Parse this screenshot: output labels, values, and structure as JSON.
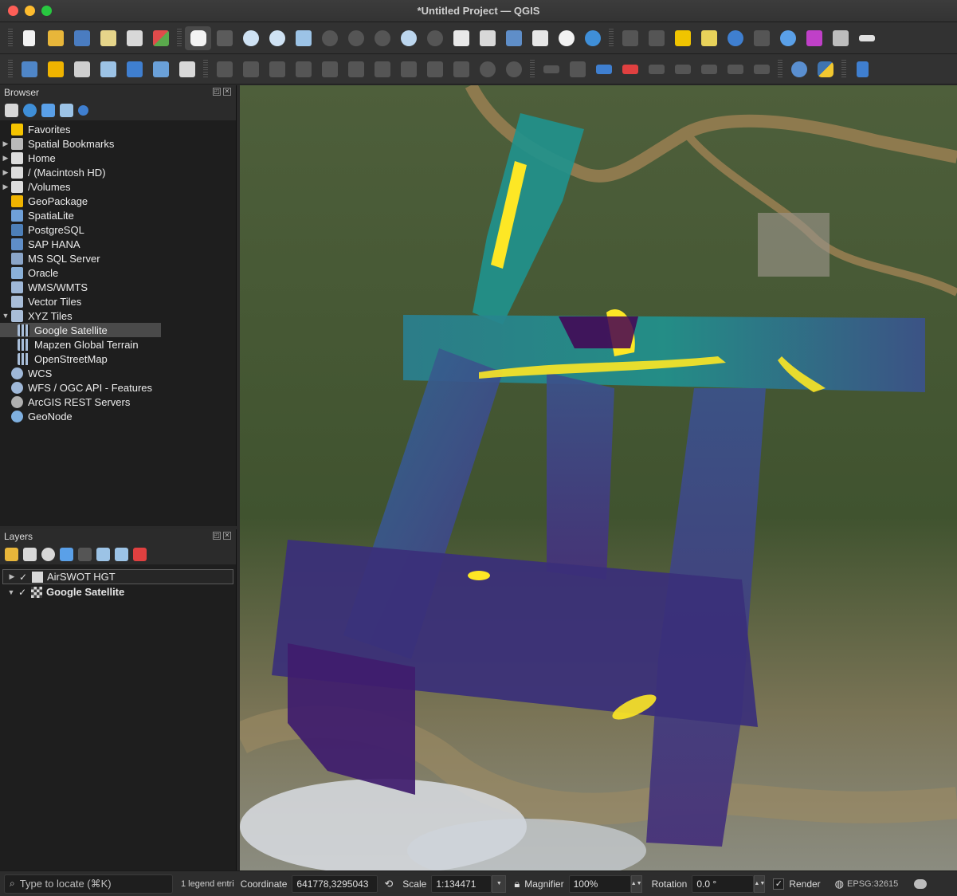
{
  "window": {
    "title": "*Untitled Project — QGIS",
    "traffic_lights": [
      "#fe5f57",
      "#febc2e",
      "#28c840"
    ]
  },
  "browser": {
    "title": "Browser",
    "items": [
      {
        "label": "Favorites",
        "icon": "star-icon",
        "color": "#f5c400",
        "arrow": ""
      },
      {
        "label": "Spatial Bookmarks",
        "icon": "bookmark-icon",
        "color": "#b9b9b9",
        "arrow": "▶"
      },
      {
        "label": "Home",
        "icon": "home-folder-icon",
        "color": "#dcdcdc",
        "arrow": "▶"
      },
      {
        "label": "/ (Macintosh HD)",
        "icon": "folder-icon",
        "color": "#dcdcdc",
        "arrow": "▶"
      },
      {
        "label": "/Volumes",
        "icon": "folder-icon",
        "color": "#dcdcdc",
        "arrow": "▶"
      },
      {
        "label": "GeoPackage",
        "icon": "geopackage-icon",
        "color": "#f0b400",
        "arrow": ""
      },
      {
        "label": "SpatiaLite",
        "icon": "spatialite-icon",
        "color": "#6fa0d8",
        "arrow": ""
      },
      {
        "label": "PostgreSQL",
        "icon": "postgresql-icon",
        "color": "#4d7fb8",
        "arrow": ""
      },
      {
        "label": "SAP HANA",
        "icon": "sap-hana-icon",
        "color": "#5f8ec8",
        "arrow": ""
      },
      {
        "label": "MS SQL Server",
        "icon": "mssql-icon",
        "color": "#8aa5c8",
        "arrow": ""
      },
      {
        "label": "Oracle",
        "icon": "oracle-icon",
        "color": "#8ab0d8",
        "arrow": ""
      },
      {
        "label": "WMS/WMTS",
        "icon": "globe-icon",
        "color": "#9fb8d8",
        "arrow": ""
      },
      {
        "label": "Vector Tiles",
        "icon": "grid-icon",
        "color": "#a8bdd8",
        "arrow": ""
      },
      {
        "label": "XYZ Tiles",
        "icon": "grid-icon",
        "color": "#a8bdd8",
        "arrow": "▼"
      }
    ],
    "xyz_children": [
      {
        "label": "Google Satellite",
        "selected": true
      },
      {
        "label": "Mapzen Global Terrain",
        "selected": false
      },
      {
        "label": "OpenStreetMap",
        "selected": false
      }
    ],
    "items_after": [
      {
        "label": "WCS",
        "icon": "globe-icon",
        "color": "#9fb8d8"
      },
      {
        "label": "WFS / OGC API - Features",
        "icon": "globe-icon",
        "color": "#9fb8d8"
      },
      {
        "label": "ArcGIS REST Servers",
        "icon": "arcgis-icon",
        "color": "#b0b0b0"
      },
      {
        "label": "GeoNode",
        "icon": "geonode-icon",
        "color": "#7fb0e0"
      }
    ]
  },
  "layers": {
    "title": "Layers",
    "items": [
      {
        "label": "AirSWOT HGT",
        "bold": false,
        "checked": "✓",
        "arrow": "▶"
      },
      {
        "label": "Google Satellite",
        "bold": true,
        "checked": "✓",
        "arrow": "▼"
      }
    ]
  },
  "statusbar": {
    "locator_placeholder": "Type to locate (⌘K)",
    "legend_text": "1 legend entri",
    "coordinate_label": "Coordinate",
    "coordinate_value": "641778,3295043",
    "scale_label": "Scale",
    "scale_value": "1:134471",
    "magnifier_label": "Magnifier",
    "magnifier_value": "100%",
    "rotation_label": "Rotation",
    "rotation_value": "0.0 °",
    "render_label": "Render",
    "render_checked": "✓",
    "crs": "EPSG:32615"
  },
  "map": {
    "colors": {
      "viridis_dark": "#440154",
      "viridis_blue": "#3b528b",
      "viridis_teal": "#21918c",
      "viridis_yellow": "#fde725",
      "land": "#4a5a33",
      "water": "#8a7a52"
    }
  }
}
